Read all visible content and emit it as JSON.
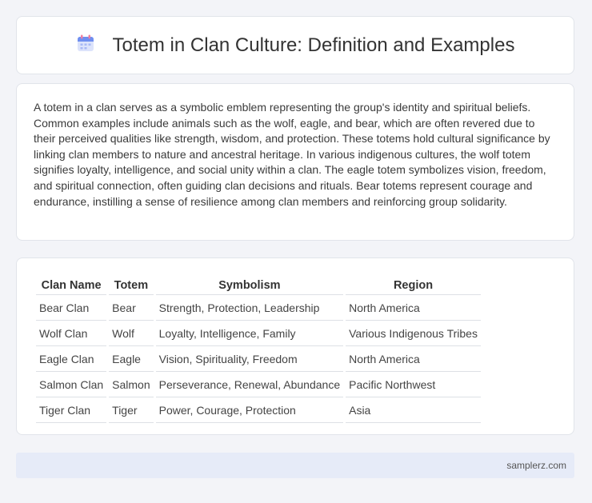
{
  "header": {
    "title": "Totem in Clan Culture: Definition and Examples",
    "icon": "calendar-icon"
  },
  "intro": {
    "text": "A totem in a clan serves as a symbolic emblem representing the group's identity and spiritual beliefs. Common examples include animals such as the wolf, eagle, and bear, which are often revered due to their perceived qualities like strength, wisdom, and protection. These totems hold cultural significance by linking clan members to nature and ancestral heritage. In various indigenous cultures, the wolf totem signifies loyalty, intelligence, and social unity within a clan. The eagle totem symbolizes vision, freedom, and spiritual connection, often guiding clan decisions and rituals. Bear totems represent courage and endurance, instilling a sense of resilience among clan members and reinforcing group solidarity."
  },
  "table": {
    "headers": [
      "Clan Name",
      "Totem",
      "Symbolism",
      "Region"
    ],
    "rows": [
      [
        "Bear Clan",
        "Bear",
        "Strength, Protection, Leadership",
        "North America"
      ],
      [
        "Wolf Clan",
        "Wolf",
        "Loyalty, Intelligence, Family",
        "Various Indigenous Tribes"
      ],
      [
        "Eagle Clan",
        "Eagle",
        "Vision, Spirituality, Freedom",
        "North America"
      ],
      [
        "Salmon Clan",
        "Salmon",
        "Perseverance, Renewal, Abundance",
        "Pacific Northwest"
      ],
      [
        "Tiger Clan",
        "Tiger",
        "Power, Courage, Protection",
        "Asia"
      ]
    ]
  },
  "footer": {
    "site": "samplerz.com"
  }
}
